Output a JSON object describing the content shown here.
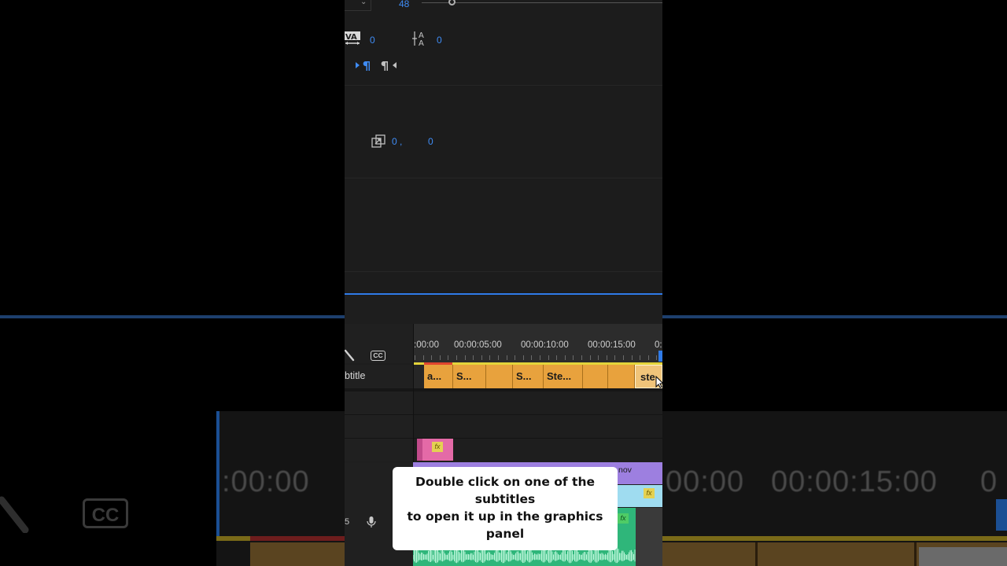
{
  "top_panel": {
    "font_size_value": "48",
    "tracking_value": "0",
    "leading_value": "0",
    "position_x": "0 ,",
    "position_y": "0"
  },
  "timeline": {
    "ruler_labels": [
      ":00:00",
      "00:00:05:00",
      "00:00:10:00",
      "00:00:15:00",
      "0:"
    ],
    "subtitle_track_label": "btitle",
    "cc_label": "CC",
    "track_number": "5",
    "clips": [
      "a...",
      "S...",
      "",
      "S...",
      "Ste...",
      "",
      "",
      "ste"
    ],
    "video_clip_label": "nov",
    "fx_label": "fx"
  },
  "background": {
    "left_time": ":00:00",
    "right_time_1": "00:00",
    "right_time_2": "00:00:15:00",
    "right_time_3": "0",
    "left_cc": "CC"
  },
  "tooltip": {
    "line1": "Double click on one of the",
    "line2": "subtitles",
    "line3": "to open it up in the graphics",
    "line4": "panel"
  },
  "colors": {
    "accent_blue": "#3f8cf5",
    "clip_orange": "#e8a23d",
    "playhead_blue": "#1473e6",
    "audio_green": "#2fb67a",
    "video_purple": "#9d7fe0",
    "fx_pink": "#e46aa7"
  }
}
